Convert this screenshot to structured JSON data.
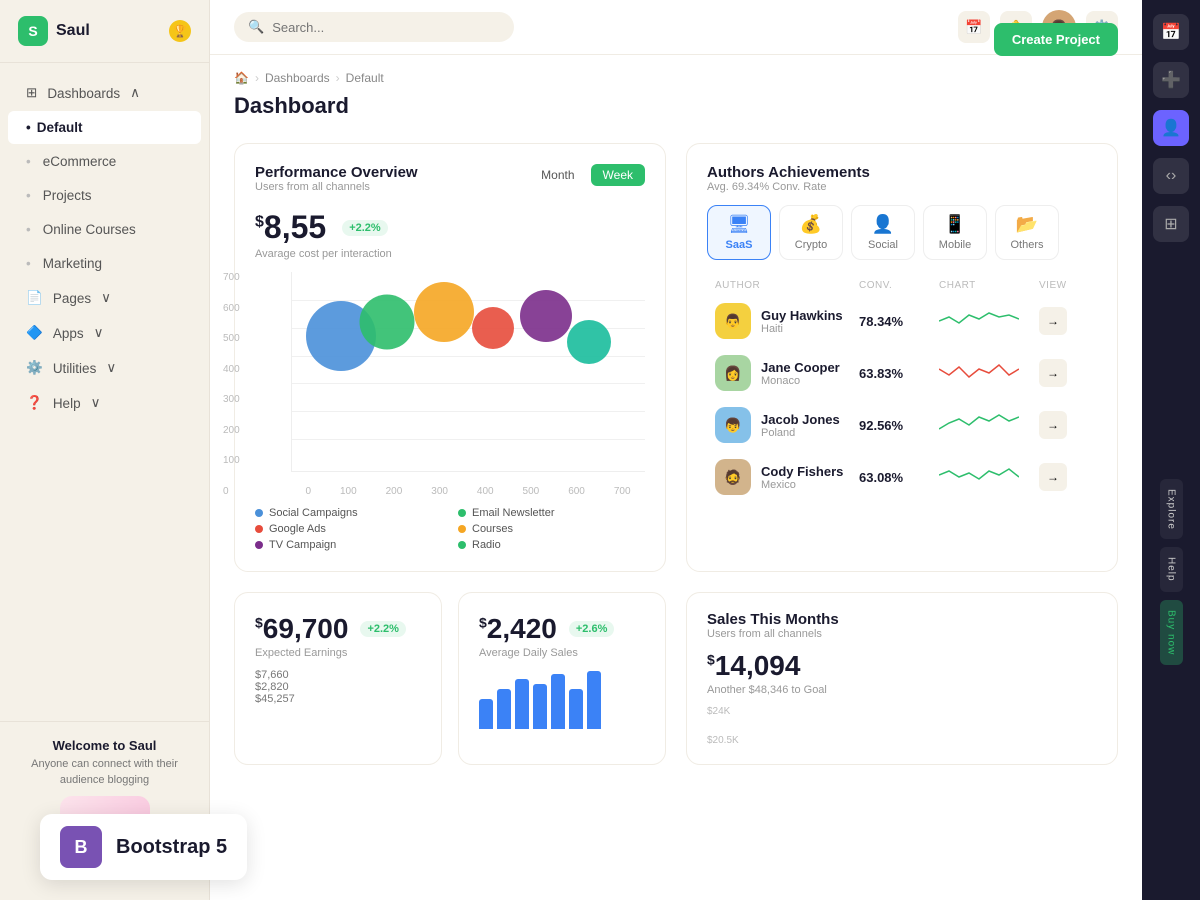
{
  "app": {
    "name": "Saul",
    "logo_letter": "S",
    "badge_icon": "🏆"
  },
  "sidebar": {
    "nav_items": [
      {
        "id": "dashboards",
        "label": "Dashboards",
        "icon": "⊞",
        "has_chevron": true,
        "active": false
      },
      {
        "id": "default",
        "label": "Default",
        "icon": "",
        "active": true
      },
      {
        "id": "ecommerce",
        "label": "eCommerce",
        "icon": "",
        "active": false
      },
      {
        "id": "projects",
        "label": "Projects",
        "icon": "",
        "active": false
      },
      {
        "id": "online-courses",
        "label": "Online Courses",
        "icon": "",
        "active": false
      },
      {
        "id": "marketing",
        "label": "Marketing",
        "icon": "",
        "active": false
      },
      {
        "id": "pages",
        "label": "Pages",
        "icon": "📄",
        "has_chevron": true,
        "active": false
      },
      {
        "id": "apps",
        "label": "Apps",
        "icon": "🔷",
        "has_chevron": true,
        "active": false
      },
      {
        "id": "utilities",
        "label": "Utilities",
        "icon": "⚙️",
        "has_chevron": true,
        "active": false
      },
      {
        "id": "help",
        "label": "Help",
        "icon": "❓",
        "has_chevron": true,
        "active": false
      }
    ],
    "welcome": {
      "title": "Welcome to Saul",
      "subtitle": "Anyone can connect with their audience blogging"
    }
  },
  "topbar": {
    "search_placeholder": "Search...",
    "search_cursor": "_"
  },
  "breadcrumb": {
    "home": "🏠",
    "items": [
      "Dashboards",
      "Default"
    ]
  },
  "page": {
    "title": "Dashboard",
    "create_btn": "Create Project"
  },
  "performance": {
    "title": "Performance Overview",
    "subtitle": "Users from all channels",
    "period_month": "Month",
    "period_week": "Week",
    "metric_value": "8,55",
    "metric_currency": "$",
    "metric_badge": "+2.2%",
    "metric_label": "Avarage cost per interaction",
    "y_labels": [
      "700",
      "600",
      "500",
      "400",
      "300",
      "200",
      "100",
      "0"
    ],
    "x_labels": [
      "0",
      "100",
      "200",
      "300",
      "400",
      "500",
      "600",
      "700"
    ],
    "bubbles": [
      {
        "x": 22,
        "y": 42,
        "size": 70,
        "color": "#4a90d9"
      },
      {
        "x": 30,
        "y": 37,
        "size": 55,
        "color": "#2dbe6c"
      },
      {
        "x": 40,
        "y": 28,
        "size": 60,
        "color": "#f5a623"
      },
      {
        "x": 56,
        "y": 28,
        "size": 45,
        "color": "#e74c3c"
      },
      {
        "x": 65,
        "y": 45,
        "size": 52,
        "color": "#7b2d8b"
      },
      {
        "x": 76,
        "y": 42,
        "size": 45,
        "color": "#1abc9c"
      }
    ],
    "legend": [
      {
        "label": "Social Campaigns",
        "color": "#4a90d9"
      },
      {
        "label": "Email Newsletter",
        "color": "#2dbe6c"
      },
      {
        "label": "Google Ads",
        "color": "#e74c3c"
      },
      {
        "label": "Courses",
        "color": "#f5a623"
      },
      {
        "label": "TV Campaign",
        "color": "#7b2d8b"
      },
      {
        "label": "Radio",
        "color": "#2dbe6c"
      }
    ]
  },
  "authors": {
    "title": "Authors Achievements",
    "subtitle": "Avg. 69.34% Conv. Rate",
    "categories": [
      {
        "id": "saas",
        "label": "SaaS",
        "icon": "🖥",
        "active": true
      },
      {
        "id": "crypto",
        "label": "Crypto",
        "icon": "💰",
        "active": false
      },
      {
        "id": "social",
        "label": "Social",
        "icon": "👤",
        "active": false
      },
      {
        "id": "mobile",
        "label": "Mobile",
        "icon": "📱",
        "active": false
      },
      {
        "id": "others",
        "label": "Others",
        "icon": "📂",
        "active": false
      }
    ],
    "table_headers": {
      "author": "AUTHOR",
      "conv": "CONV.",
      "chart": "CHART",
      "view": "VIEW"
    },
    "rows": [
      {
        "name": "Guy Hawkins",
        "location": "Haiti",
        "conv": "78.34%",
        "color": "#f4d03f",
        "chart_color": "#2dbe6c"
      },
      {
        "name": "Jane Cooper",
        "location": "Monaco",
        "conv": "63.83%",
        "color": "#a8d5a2",
        "chart_color": "#e74c3c"
      },
      {
        "name": "Jacob Jones",
        "location": "Poland",
        "conv": "92.56%",
        "color": "#85c1e9",
        "chart_color": "#2dbe6c"
      },
      {
        "name": "Cody Fishers",
        "location": "Mexico",
        "conv": "63.08%",
        "color": "#d2b48c",
        "chart_color": "#2dbe6c"
      }
    ]
  },
  "stats": {
    "earnings": {
      "currency": "$",
      "value": "69,700",
      "badge": "+2.2%",
      "label": "Expected Earnings"
    },
    "daily_sales": {
      "currency": "$",
      "value": "2,420",
      "badge": "+2.6%",
      "label": "Average Daily Sales"
    },
    "amounts": [
      "$7,660",
      "$2,820",
      "$45,257"
    ]
  },
  "sales": {
    "title": "Sales This Months",
    "subtitle": "Users from all channels",
    "currency": "$",
    "value": "14,094",
    "goal_text": "Another $48,346 to Goal",
    "y_labels": [
      "$24K",
      "$20.5K"
    ]
  },
  "right_sidebar": {
    "buttons": [
      "Explore",
      "Help",
      "Buy now"
    ]
  },
  "bootstrap_badge": {
    "icon": "B",
    "label": "Bootstrap 5"
  }
}
